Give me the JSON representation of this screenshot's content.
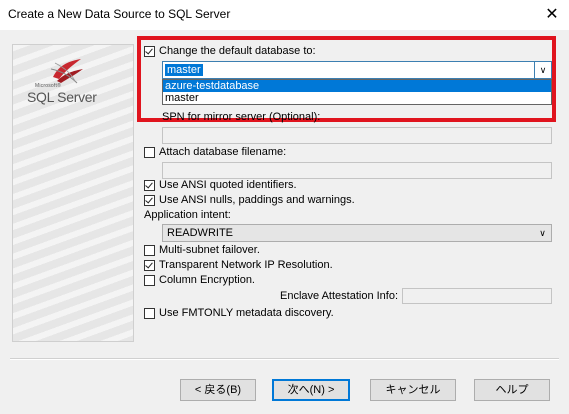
{
  "window": {
    "title": "Create a New Data Source to SQL Server",
    "close_glyph": "✕"
  },
  "logo": {
    "brand_small": "Microsoft®",
    "brand_text": "SQL Server"
  },
  "default_db": {
    "label": "Change the default database to:",
    "checked": true,
    "selected_value": "master",
    "options": [
      "azure-testdatabase",
      "master"
    ],
    "highlighted_option": "azure-testdatabase"
  },
  "spn": {
    "label": "SPN for mirror server (Optional):",
    "value": ""
  },
  "attach_db": {
    "label": "Attach database filename:",
    "checked": false,
    "value": ""
  },
  "ansi_quoted": {
    "label": "Use ANSI quoted identifiers.",
    "checked": true
  },
  "ansi_nulls": {
    "label": "Use ANSI nulls, paddings and warnings.",
    "checked": true
  },
  "app_intent": {
    "label": "Application intent:",
    "value": "READWRITE"
  },
  "multi_subnet": {
    "label": "Multi-subnet failover.",
    "checked": false
  },
  "transparent_ip": {
    "label": "Transparent Network IP Resolution.",
    "checked": true
  },
  "column_encryption": {
    "label": "Column Encryption.",
    "checked": false
  },
  "enclave": {
    "label": "Enclave Attestation Info:",
    "value": ""
  },
  "fmtonly": {
    "label": "Use FMTONLY metadata discovery.",
    "checked": false
  },
  "buttons": {
    "back": "< 戻る(B)",
    "next": "次へ(N) >",
    "cancel": "キャンセル",
    "help": "ヘルプ"
  },
  "colors": {
    "highlight_border": "#e0141e",
    "selection": "#0078d7"
  }
}
